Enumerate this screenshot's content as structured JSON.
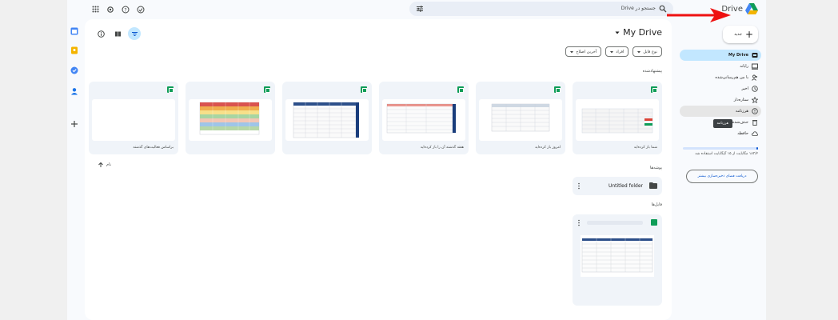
{
  "app": {
    "name": "Drive",
    "brand_colors": {
      "blue": "#4285f4",
      "green": "#0f9d58",
      "yellow": "#f4b400",
      "red": "#db4437",
      "accent": "#c2e7ff"
    }
  },
  "search": {
    "placeholder": "جستجو در Drive",
    "icon": "search-icon",
    "tune_icon": "tune-icon"
  },
  "header_icons": [
    "offline-icon",
    "help-icon",
    "settings-icon",
    "apps-grid-icon"
  ],
  "main": {
    "title": "My Drive",
    "filters": [
      "نوع فایل",
      "افراد",
      "آخرین اصلاح"
    ],
    "suggested_label": "پیشنهادشده",
    "suggested": [
      {
        "caption": "شما باز کرده‌اید"
      },
      {
        "caption": "امروز باز کرده‌اید"
      },
      {
        "caption": "هفته گذشته آن را باز کرده‌اید"
      },
      {
        "caption": ""
      },
      {
        "caption": ""
      },
      {
        "caption": "براساس فعالیت‌های گذشته"
      }
    ],
    "sort_label": "نام",
    "folders_label": "پوشه‌ها",
    "folder_name": "Untitled folder",
    "files_label": "فایل‌ها"
  },
  "sidebar": {
    "new_label": "جدید",
    "items": [
      {
        "label": "My Drive",
        "icon": "my-drive-icon"
      },
      {
        "label": "رایانه",
        "icon": "computer-icon"
      },
      {
        "label": "با من هم‌رسانی‌شده",
        "icon": "shared-icon"
      },
      {
        "label": "اخیر",
        "icon": "clock-icon"
      },
      {
        "label": "ستاره‌دار",
        "icon": "star-icon"
      },
      {
        "label": "هرزنامه",
        "icon": "spam-icon"
      },
      {
        "label": "حذف‌شده‌ها",
        "icon": "trash-icon"
      },
      {
        "label": "حافظه",
        "icon": "cloud-icon"
      }
    ],
    "tooltip": "هرزنامه",
    "storage_fraction": 0.01,
    "storage_text": "۱۸۳/۲ مگابایت از ۱۵ گیگابایت استفاده شد",
    "storage_button": "دریافت فضای ذخیره‌سازی بیشتر"
  }
}
